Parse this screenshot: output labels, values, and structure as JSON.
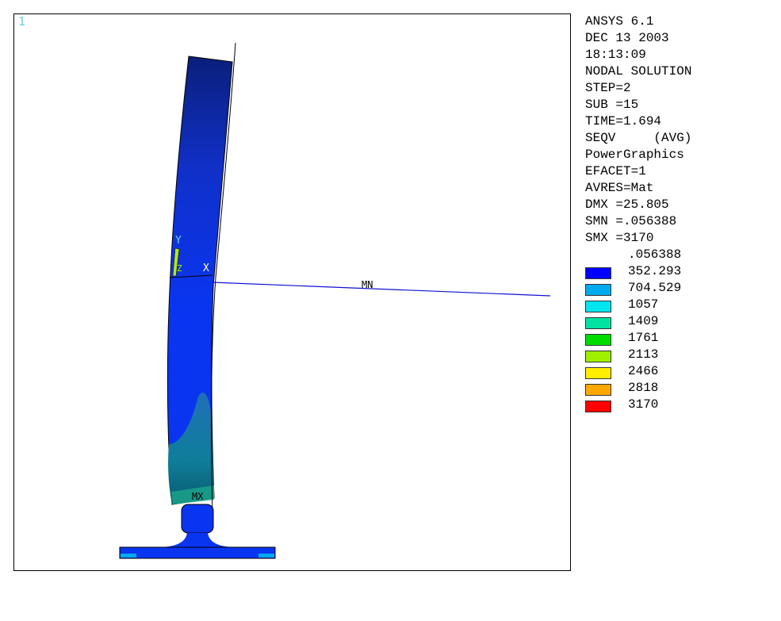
{
  "window_number": "1",
  "info_lines": [
    "ANSYS 6.1",
    "DEC 13 2003",
    "18:13:09",
    "NODAL SOLUTION",
    "STEP=2",
    "SUB =15",
    "TIME=1.694",
    "SEQV     (AVG)",
    "PowerGraphics",
    "EFACET=1",
    "AVRES=Mat",
    "DMX =25.805",
    "SMN =.056388",
    "SMX =3170"
  ],
  "legend": {
    "min_label": ".056388",
    "levels": [
      {
        "value": "352.293",
        "color": "#0000ff"
      },
      {
        "value": "704.529",
        "color": "#00aaee"
      },
      {
        "value": "1057",
        "color": "#00e5ee"
      },
      {
        "value": "1409",
        "color": "#00e3a0"
      },
      {
        "value": "1761",
        "color": "#00dc00"
      },
      {
        "value": "2113",
        "color": "#9fef00"
      },
      {
        "value": "2466",
        "color": "#ffee00"
      },
      {
        "value": "2818",
        "color": "#ffa800"
      },
      {
        "value": "3170",
        "color": "#ff0000"
      }
    ]
  },
  "triad": {
    "y_label": "Y",
    "x_label": "X",
    "z_label": "Z"
  },
  "markers": {
    "min": "MN",
    "max": "MX"
  }
}
